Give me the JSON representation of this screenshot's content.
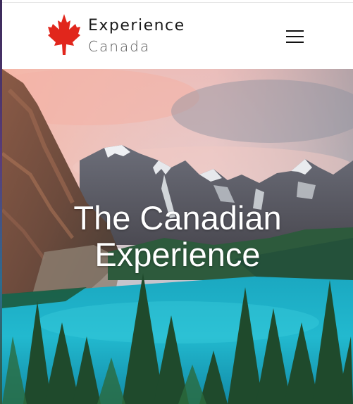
{
  "header": {
    "logo": {
      "line1": "Experience",
      "line2": "Canada",
      "icon": "maple-leaf-icon",
      "icon_color": "#e1261c"
    },
    "menu": {
      "icon": "hamburger-menu-icon"
    }
  },
  "hero": {
    "title_line1": "The Canadian",
    "title_line2": "Experience",
    "image": "moraine-lake-mountains"
  },
  "colors": {
    "lake": "#1fb3c9",
    "sky_pink": "#f2b5ad",
    "forest": "#1f4f30"
  }
}
